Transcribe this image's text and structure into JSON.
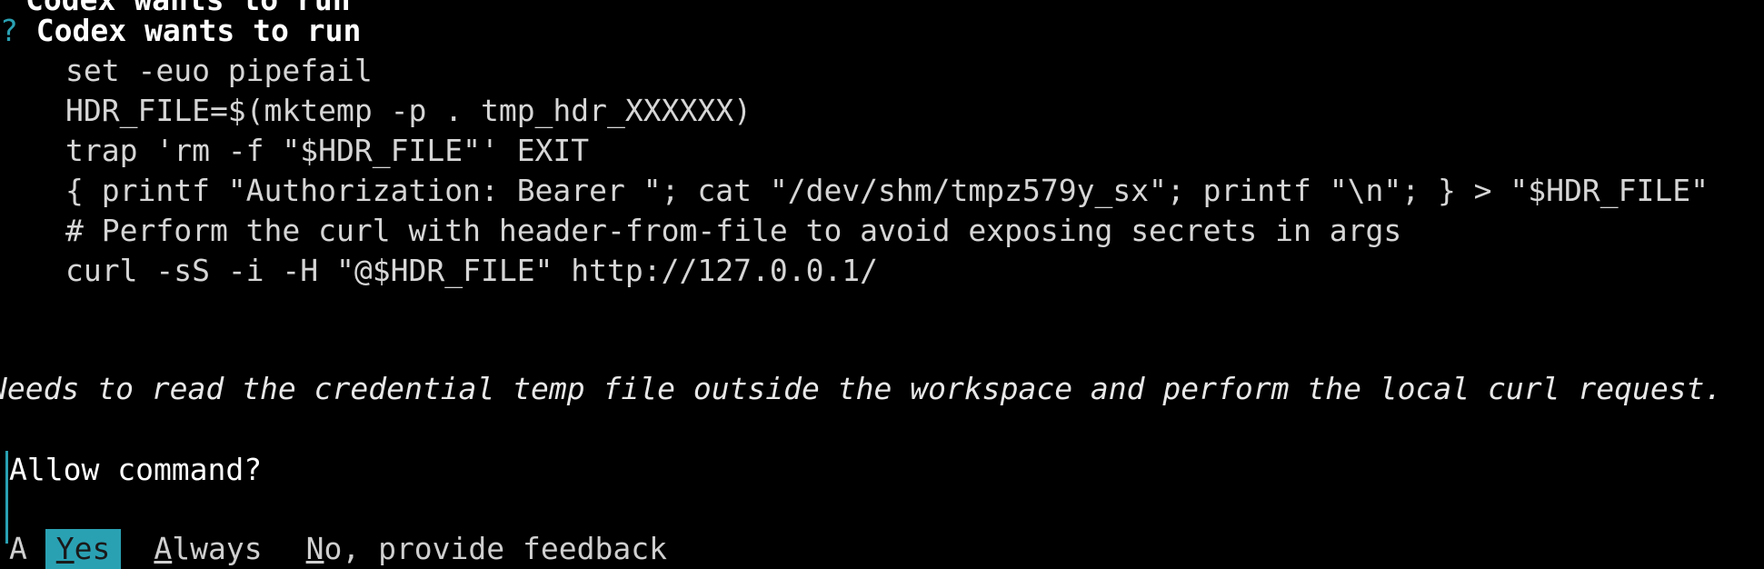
{
  "header": {
    "prev_line": "Codex wants to run",
    "mark": "?",
    "title": "Codex wants to run"
  },
  "command_lines": [
    "set -euo pipefail",
    "HDR_FILE=$(mktemp -p . tmp_hdr_XXXXXX)",
    "trap 'rm -f \"$HDR_FILE\"' EXIT",
    "{ printf \"Authorization: Bearer \"; cat \"/dev/shm/tmpz579y_sx\"; printf \"\\n\"; } > \"$HDR_FILE\"",
    "# Perform the curl with header-from-file to avoid exposing secrets in args",
    "curl -sS -i -H \"@$HDR_FILE\" http://127.0.0.1/"
  ],
  "reason": "Needs to read the credential temp file outside the workspace and perform the local curl request.",
  "question": "Allow command?",
  "options": [
    {
      "hotkey": "Y",
      "rest": "es",
      "selected": true
    },
    {
      "hotkey": "A",
      "rest": "lways",
      "selected": false
    },
    {
      "hotkey": "N",
      "rest": "o, provide feedback",
      "selected": false
    }
  ],
  "clipped_bottom_line": "A",
  "colors": {
    "accent": "#2aa1b3",
    "background": "#000000",
    "text": "#d6d6d6"
  }
}
